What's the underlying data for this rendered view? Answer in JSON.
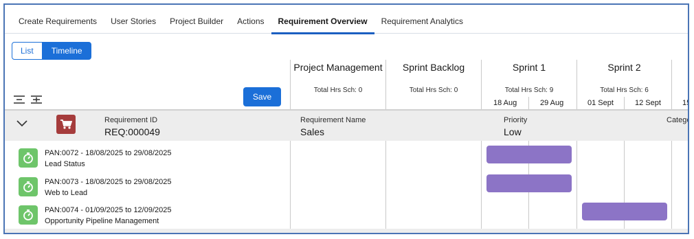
{
  "tabs": [
    {
      "label": "Create Requirements"
    },
    {
      "label": "User Stories"
    },
    {
      "label": "Project Builder"
    },
    {
      "label": "Actions"
    },
    {
      "label": "Requirement Overview",
      "active": true
    },
    {
      "label": "Requirement Analytics"
    }
  ],
  "view_toggle": {
    "list": "List",
    "timeline": "Timeline",
    "selected": "Timeline"
  },
  "icons": {
    "collapse_all": "collapse-all-icon",
    "expand_all": "expand-all-icon",
    "row_toggle": "chevron-down-icon",
    "requirement": "shopping-cart-icon",
    "task": "stopwatch-icon"
  },
  "save_label": "Save",
  "columns": [
    {
      "title": "Project Management",
      "hrs": "Total Hrs Sch: 0"
    },
    {
      "title": "Sprint Backlog",
      "hrs": "Total Hrs Sch: 0"
    },
    {
      "title": "Sprint 1",
      "hrs": "Total Hrs Sch: 9",
      "dates": [
        "18 Aug",
        "29 Aug"
      ]
    },
    {
      "title": "Sprint 2",
      "hrs": "Total Hrs Sch: 6",
      "dates": [
        "01 Sept",
        "12 Sept"
      ]
    },
    {
      "dates": [
        "15"
      ]
    }
  ],
  "requirement": {
    "id_label": "Requirement ID",
    "id_value": "REQ:000049",
    "name_label": "Requirement Name",
    "name_value": "Sales",
    "priority_label": "Priority",
    "priority_value": "Low",
    "category_label": "Catego"
  },
  "tasks": [
    {
      "line1": "PAN:0072 - 18/08/2025 to 29/08/2025",
      "line2": "Lead Status",
      "sprint": "Sprint 1"
    },
    {
      "line1": "PAN:0073 - 18/08/2025 to 29/08/2025",
      "line2": "Web to Lead",
      "sprint": "Sprint 1"
    },
    {
      "line1": "PAN:0074 - 01/09/2025 to 12/09/2025",
      "line2": "Opportunity Pipeline Management",
      "sprint": "Sprint 2"
    }
  ],
  "colors": {
    "accent": "#1b6fd8",
    "bar": "#8c74c6",
    "task_icon": "#6ec56a",
    "req_icon": "#a53c3c",
    "frame": "#4a74b5"
  }
}
